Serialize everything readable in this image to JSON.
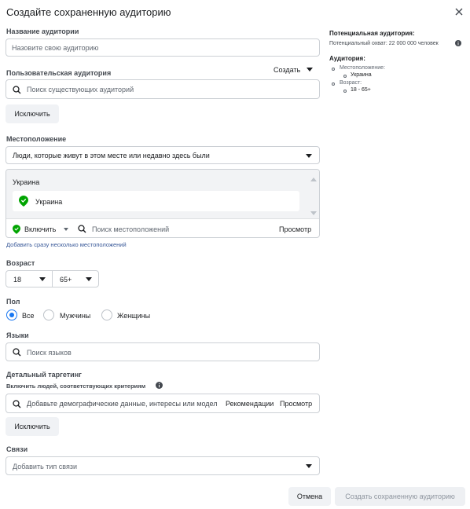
{
  "dialog": {
    "title": "Создайте сохраненную аудиторию"
  },
  "audience_name": {
    "label": "Название аудитории",
    "placeholder": "Назовите свою аудиторию"
  },
  "custom_audience": {
    "label": "Пользовательская аудитория",
    "create_label": "Создать",
    "search_placeholder": "Поиск существующих аудиторий",
    "exclude_label": "Исключить"
  },
  "location": {
    "label": "Местоположение",
    "type_value": "Люди, которые живут в этом месте или недавно здесь были",
    "group_header": "Украина",
    "item": "Украина",
    "include_label": "Включить",
    "search_placeholder": "Поиск местоположений",
    "browse_label": "Просмотр",
    "bulk_link": "Добавить сразу несколько местоположений"
  },
  "age": {
    "label": "Возраст",
    "from": "18",
    "to": "65+"
  },
  "gender": {
    "label": "Пол",
    "options": [
      "Все",
      "Мужчины",
      "Женщины"
    ],
    "selected": "Все"
  },
  "languages": {
    "label": "Языки",
    "placeholder": "Поиск языков"
  },
  "detailed_targeting": {
    "label": "Детальный таргетинг",
    "sublabel": "Включить людей, соответствующих критериям",
    "placeholder": "Добавьте демографические данные, интересы или модел",
    "suggestions_label": "Рекомендации",
    "browse_label": "Просмотр",
    "exclude_label": "Исключить"
  },
  "connections": {
    "label": "Связи",
    "placeholder": "Добавить тип связи"
  },
  "footer": {
    "cancel_label": "Отмена",
    "create_label": "Создать сохраненную аудиторию"
  },
  "summary": {
    "title": "Потенциальная аудитория:",
    "reach": "Потенциальный охват: 22 000 000 человек",
    "audience_title": "Аудитория:",
    "location_label": "Местоположение:",
    "location_value": "Украина",
    "age_label": "Возраст:",
    "age_value": "18 - 65+"
  },
  "colors": {
    "primary": "#1877f2",
    "green": "#00a400",
    "link": "#385898"
  }
}
